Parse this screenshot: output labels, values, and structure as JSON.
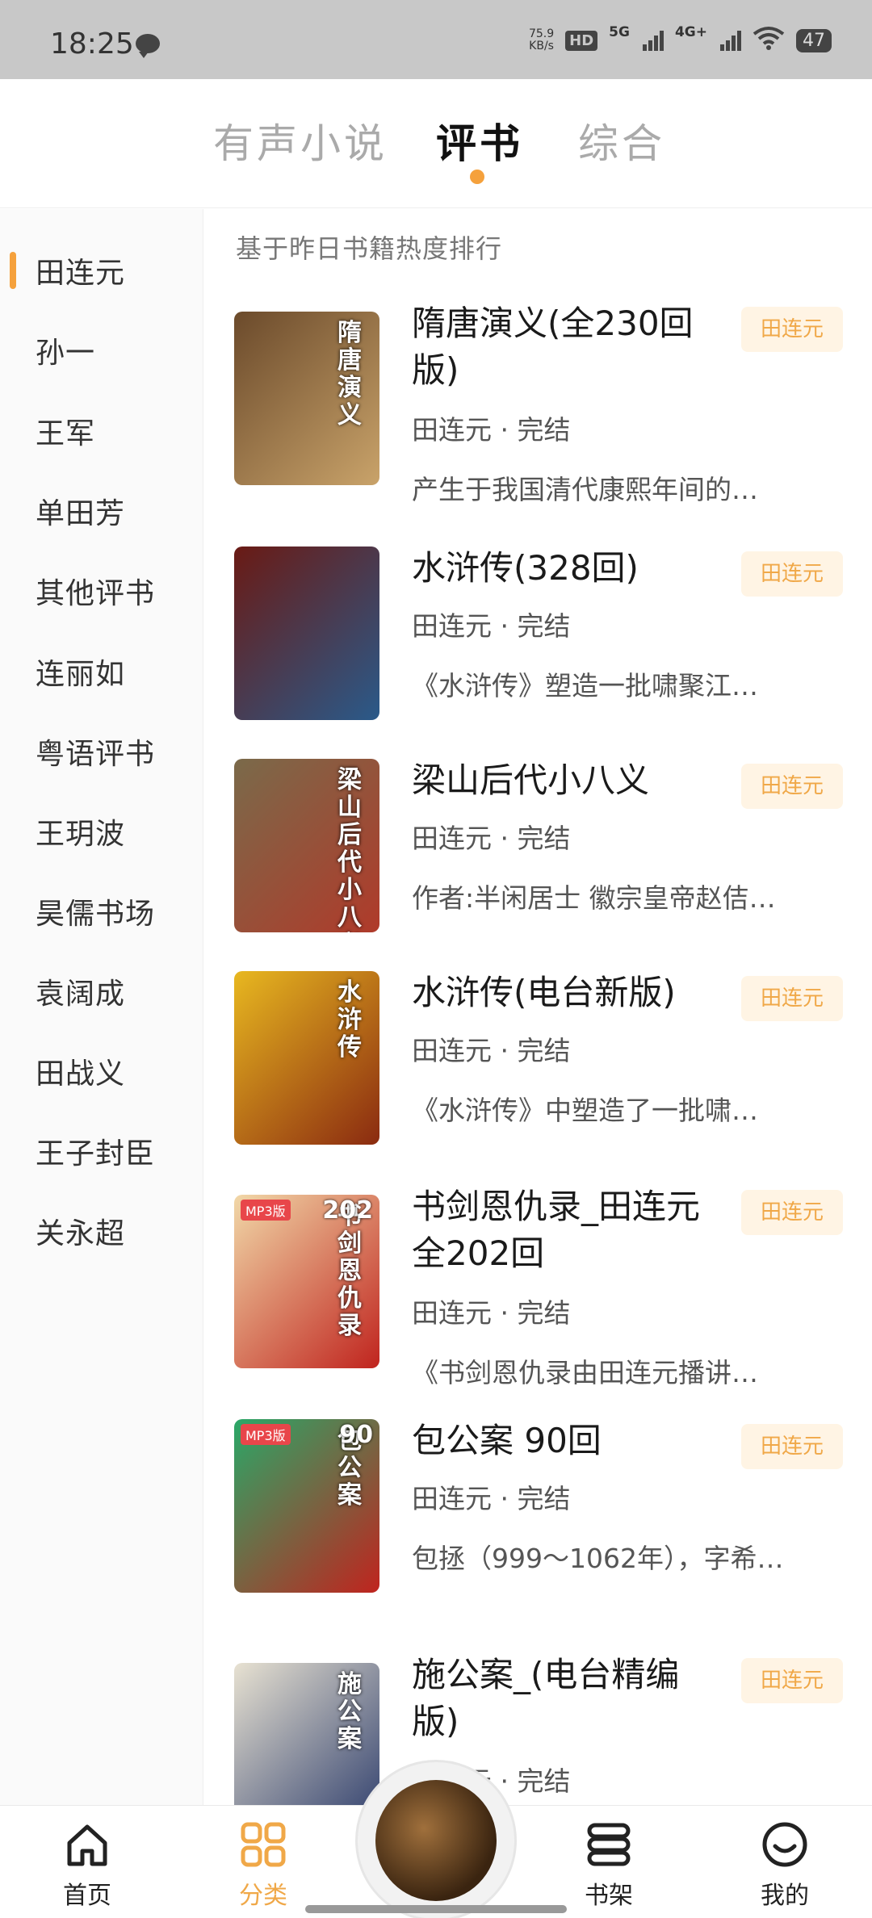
{
  "status_bar": {
    "time": "18:25",
    "net_speed_value": "75.9",
    "net_speed_unit": "KB/s",
    "hd_badge": "HD",
    "net_1": "5G",
    "net_2": "4G+",
    "battery": "47"
  },
  "top_tabs": [
    {
      "label": "有声小说",
      "active": false
    },
    {
      "label": "评书",
      "active": true
    },
    {
      "label": "综合",
      "active": false
    }
  ],
  "sidebar": {
    "selected_index": 0,
    "items": [
      {
        "label": "田连元"
      },
      {
        "label": "孙一"
      },
      {
        "label": "王军"
      },
      {
        "label": "单田芳"
      },
      {
        "label": "其他评书"
      },
      {
        "label": "连丽如"
      },
      {
        "label": "粤语评书"
      },
      {
        "label": "王玥波"
      },
      {
        "label": "昊儒书场"
      },
      {
        "label": "袁阔成"
      },
      {
        "label": "田战义"
      },
      {
        "label": "王子封臣"
      },
      {
        "label": "关永超"
      }
    ]
  },
  "rank_note": "基于昨日书籍热度排行",
  "books": [
    {
      "title": "隋唐演义(全230回版)",
      "meta": "田连元 · 完结",
      "desc": "产生于我国清代康熙年间的…",
      "tag": "田连元",
      "cover_text": "隋唐演义",
      "cover_colors": [
        "#6b4a2b",
        "#c9a36a"
      ]
    },
    {
      "title": "水浒传(328回)",
      "meta": "田连元 · 完结",
      "desc": "《水浒传》塑造一批啸聚江…",
      "tag": "田连元",
      "cover_text": "",
      "cover_colors": [
        "#6a1a14",
        "#2a5a8a"
      ]
    },
    {
      "title": "梁山后代小八义",
      "meta": "田连元 · 完结",
      "desc": "作者:半闲居士 徽宗皇帝赵佶…",
      "tag": "田连元",
      "cover_text": "梁山后代小八义",
      "cover_colors": [
        "#7a6a4a",
        "#b03a2a"
      ]
    },
    {
      "title": "水浒传(电台新版)",
      "meta": "田连元 · 完结",
      "desc": "《水浒传》中塑造了一批啸…",
      "tag": "田连元",
      "cover_text": "水浒传",
      "cover_colors": [
        "#e8b820",
        "#8a2a10"
      ]
    },
    {
      "title": "书剑恩仇录_田连元 全202回",
      "meta": "田连元 · 完结",
      "desc": "《书剑恩仇录由田连元播讲…",
      "tag": "田连元",
      "cover_text": "书剑恩仇录",
      "cover_badge": "MP3版",
      "cover_number": "202",
      "cover_colors": [
        "#f1d8a8",
        "#c0241e"
      ]
    },
    {
      "title": "包公案 90回",
      "meta": "田连元 · 完结",
      "desc": "包拯（999～1062年），字希…",
      "tag": "田连元",
      "cover_text": "包公案",
      "cover_badge": "MP3版",
      "cover_number": "90",
      "cover_colors": [
        "#2aa868",
        "#c0241e"
      ]
    },
    {
      "title": "施公案_(电台精编版)",
      "meta": "田连元 · 完结",
      "desc": "",
      "tag": "田连元",
      "cover_text": "施公案",
      "cover_colors": [
        "#e8e2d2",
        "#2a3a6a"
      ]
    }
  ],
  "bottom_nav": [
    {
      "label": "首页",
      "icon": "home-icon",
      "active": false
    },
    {
      "label": "分类",
      "icon": "category-grid-icon",
      "active": true
    },
    {
      "label": "书架",
      "icon": "bookshelf-icon",
      "active": false
    },
    {
      "label": "我的",
      "icon": "profile-smile-icon",
      "active": false
    }
  ],
  "colors": {
    "accent": "#f5a13c",
    "tag_bg": "#fff4e4",
    "tag_text": "#f0a848"
  }
}
